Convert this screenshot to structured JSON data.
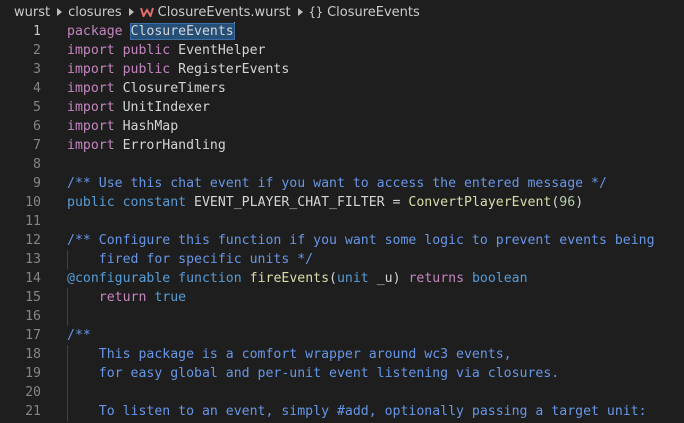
{
  "breadcrumb": {
    "items": [
      "wurst",
      "closures",
      "ClosureEvents.wurst",
      "ClosureEvents"
    ]
  },
  "editor": {
    "active_line": "1",
    "lines": [
      {
        "n": "1",
        "tokens": [
          [
            "kw-import",
            "package "
          ],
          [
            "sel",
            "ClosureEvents"
          ]
        ]
      },
      {
        "n": "2",
        "tokens": [
          [
            "kw-import",
            "import "
          ],
          [
            "kw-import",
            "public "
          ],
          [
            "ident",
            "EventHelper"
          ]
        ]
      },
      {
        "n": "3",
        "tokens": [
          [
            "kw-import",
            "import "
          ],
          [
            "kw-import",
            "public "
          ],
          [
            "ident",
            "RegisterEvents"
          ]
        ]
      },
      {
        "n": "4",
        "tokens": [
          [
            "kw-import",
            "import "
          ],
          [
            "ident",
            "ClosureTimers"
          ]
        ]
      },
      {
        "n": "5",
        "tokens": [
          [
            "kw-import",
            "import "
          ],
          [
            "ident",
            "UnitIndexer"
          ]
        ]
      },
      {
        "n": "6",
        "tokens": [
          [
            "kw-import",
            "import "
          ],
          [
            "ident",
            "HashMap"
          ]
        ]
      },
      {
        "n": "7",
        "tokens": [
          [
            "kw-import",
            "import "
          ],
          [
            "ident",
            "ErrorHandling"
          ]
        ]
      },
      {
        "n": "8",
        "tokens": []
      },
      {
        "n": "9",
        "tokens": [
          [
            "doc",
            "/** Use this chat event if you want to access the entered message */"
          ]
        ]
      },
      {
        "n": "10",
        "tokens": [
          [
            "kw-decl",
            "public "
          ],
          [
            "kw-decl",
            "constant "
          ],
          [
            "ident",
            "EVENT_PLAYER_CHAT_FILTER = "
          ],
          [
            "func",
            "ConvertPlayerEvent"
          ],
          [
            "ident",
            "("
          ],
          [
            "num",
            "96"
          ],
          [
            "ident",
            ")"
          ]
        ]
      },
      {
        "n": "11",
        "tokens": []
      },
      {
        "n": "12",
        "tokens": [
          [
            "doc",
            "/** Configure this function if you want some logic to prevent events being"
          ]
        ]
      },
      {
        "n": "13",
        "tokens": [
          [
            "doc",
            "    fired for specific units */"
          ]
        ],
        "guide": true
      },
      {
        "n": "14",
        "tokens": [
          [
            "kw-decl",
            "@configurable "
          ],
          [
            "kw-decl",
            "function "
          ],
          [
            "func",
            "fireEvents"
          ],
          [
            "ident",
            "("
          ],
          [
            "kw-decl",
            "unit "
          ],
          [
            "ident",
            "_u) "
          ],
          [
            "kw-import",
            "returns "
          ],
          [
            "kw-decl",
            "boolean"
          ]
        ]
      },
      {
        "n": "15",
        "tokens": [
          [
            "ident",
            "    "
          ],
          [
            "kw-import",
            "return "
          ],
          [
            "kw-decl",
            "true"
          ]
        ],
        "guide": true
      },
      {
        "n": "16",
        "tokens": [],
        "guide": true
      },
      {
        "n": "17",
        "tokens": [
          [
            "doc",
            "/**"
          ]
        ]
      },
      {
        "n": "18",
        "tokens": [
          [
            "doc",
            "    This package is a comfort wrapper around wc3 events,"
          ]
        ],
        "guide": true
      },
      {
        "n": "19",
        "tokens": [
          [
            "doc",
            "    for easy global and per-unit event listening via closures."
          ]
        ],
        "guide": true
      },
      {
        "n": "20",
        "tokens": [],
        "guide": true
      },
      {
        "n": "21",
        "tokens": [
          [
            "doc",
            "    To listen to an event, simply #add, optionally passing a target unit:"
          ]
        ],
        "guide": true
      }
    ]
  }
}
